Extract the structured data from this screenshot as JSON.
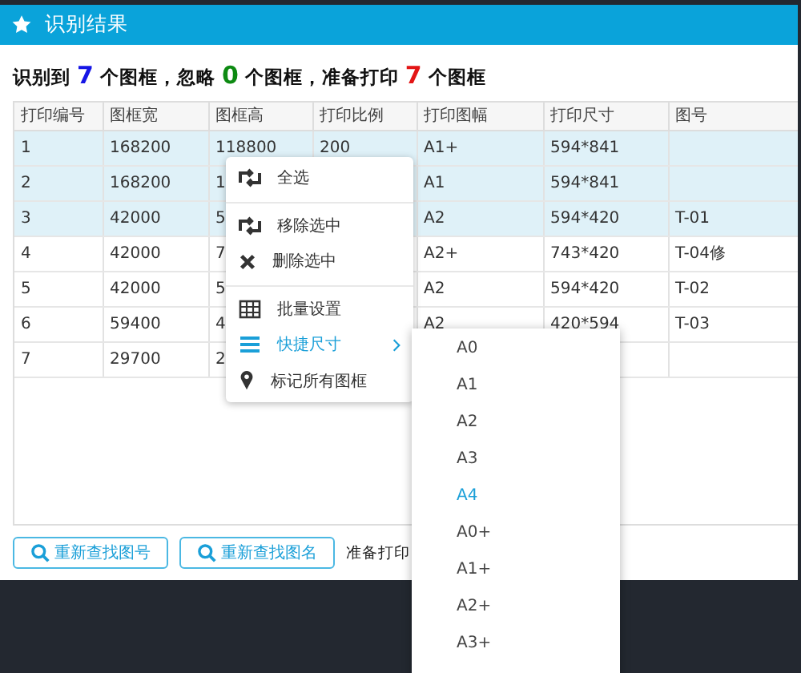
{
  "window": {
    "title": "识别结果"
  },
  "summary": [
    {
      "kind": "text",
      "text": "识别到"
    },
    {
      "kind": "count",
      "text": "7",
      "color": "#1616e6"
    },
    {
      "kind": "text",
      "text": "个图框，忽略"
    },
    {
      "kind": "count",
      "text": "0",
      "color": "#0d8a12"
    },
    {
      "kind": "text",
      "text": "个图框，准备打印"
    },
    {
      "kind": "count",
      "text": "7",
      "color": "#e31515"
    },
    {
      "kind": "text",
      "text": "个图框"
    }
  ],
  "table": {
    "columns": [
      "打印编号",
      "图框宽",
      "图框高",
      "打印比例",
      "打印图幅",
      "打印尺寸",
      "图号"
    ],
    "rows": [
      {
        "selected": true,
        "cells": [
          "1",
          "168200",
          "118800",
          "200",
          "A1+",
          "594*841",
          null
        ]
      },
      {
        "selected": true,
        "cells": [
          "2",
          "168200",
          "1",
          null,
          "A1",
          "594*841",
          null
        ]
      },
      {
        "selected": true,
        "cells": [
          "3",
          "42000",
          "5",
          null,
          "A2",
          "594*420",
          "T-01"
        ]
      },
      {
        "selected": false,
        "cells": [
          "4",
          "42000",
          "7",
          null,
          "A2+",
          "743*420",
          "T-04修"
        ]
      },
      {
        "selected": false,
        "cells": [
          "5",
          "42000",
          "5",
          null,
          "A2",
          "594*420",
          "T-02"
        ]
      },
      {
        "selected": false,
        "cells": [
          "6",
          "59400",
          "4",
          null,
          "A2",
          "420*594",
          "T-03"
        ]
      },
      {
        "selected": false,
        "cells": [
          "7",
          "29700",
          "2",
          null,
          null,
          null,
          null
        ]
      }
    ]
  },
  "buttons": [
    {
      "label": "重新查找图号"
    },
    {
      "label": "重新查找图名"
    }
  ],
  "status_text": "准备打印",
  "context_menu": {
    "items": [
      {
        "kind": "item",
        "label": "全选",
        "selected": false
      },
      {
        "kind": "divider"
      },
      {
        "kind": "item",
        "label": "移除选中",
        "selected": false
      },
      {
        "kind": "item",
        "label": "删除选中",
        "selected": false
      },
      {
        "kind": "divider"
      },
      {
        "kind": "item",
        "label": "批量设置",
        "selected": false
      },
      {
        "kind": "submenu",
        "label": "快捷尺寸",
        "selected": true
      },
      {
        "kind": "item",
        "label": "标记所有图框",
        "selected": false
      }
    ]
  },
  "submenu": {
    "items": [
      {
        "label": "A0",
        "selected": false
      },
      {
        "label": "A1",
        "selected": false
      },
      {
        "label": "A2",
        "selected": false
      },
      {
        "label": "A3",
        "selected": false
      },
      {
        "label": "A4",
        "selected": true
      },
      {
        "label": "A0+",
        "selected": false
      },
      {
        "label": "A1+",
        "selected": false
      },
      {
        "label": "A2+",
        "selected": false
      },
      {
        "label": "A3+",
        "selected": false
      }
    ]
  }
}
